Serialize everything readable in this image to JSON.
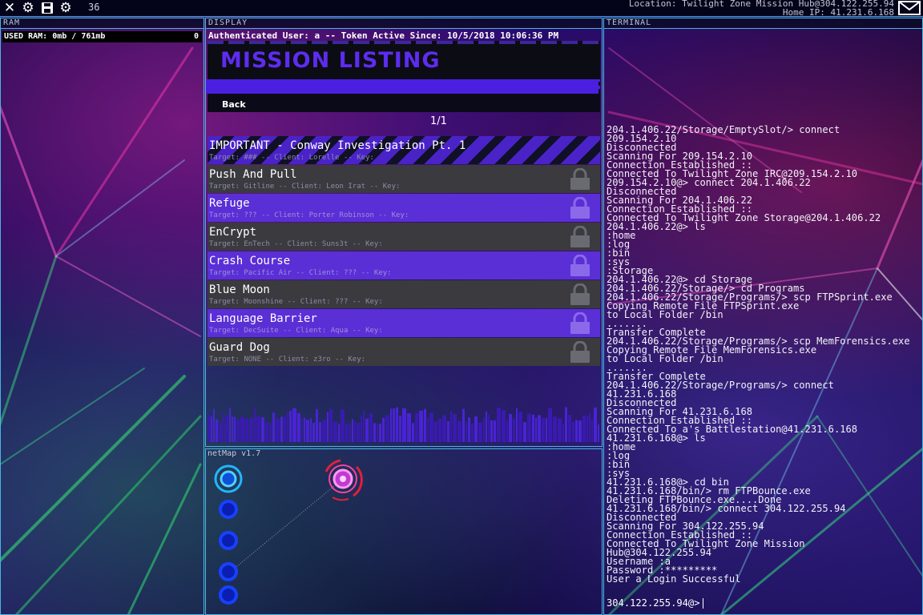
{
  "topbar": {
    "icons": [
      "close-icon",
      "gear-icon",
      "save-icon",
      "settings-icon"
    ],
    "counter": "36",
    "location": "Location: Twilight Zone Mission Hub@304.122.255.94",
    "home_ip": "Home IP: 41.231.6.168"
  },
  "ram": {
    "header": "RAM",
    "used_label": "USED RAM: 0mb / 761mb",
    "count": "0"
  },
  "display": {
    "header": "DISPLAY",
    "auth": "Authenticated User: a -- Token Active Since: 10/5/2018 10:06:36 PM",
    "title": "MISSION LISTING",
    "back_label": "Back",
    "page": "1/1",
    "missions": [
      {
        "title": "IMPORTANT - Conway Investigation Pt. 1",
        "sub": "Target: ### -- Client: Lorelle -- Key:",
        "style": "important",
        "locked": false
      },
      {
        "title": "Push And Pull",
        "sub": "Target: Gitline -- Client: Leon Irat -- Key:",
        "style": "dark",
        "locked": true
      },
      {
        "title": "Refuge",
        "sub": "Target: ??? -- Client: Porter Robinson -- Key:",
        "style": "purple",
        "locked": true
      },
      {
        "title": "EnCrypt",
        "sub": "Target: EnTech -- Client: Suns3t -- Key:",
        "style": "dark",
        "locked": true
      },
      {
        "title": "Crash Course",
        "sub": "Target: Pacific Air -- Client: ??? -- Key:",
        "style": "purple",
        "locked": true
      },
      {
        "title": "Blue Moon",
        "sub": "Target: Moonshine -- Client: ??? -- Key:",
        "style": "dark",
        "locked": true
      },
      {
        "title": "Language Barrier",
        "sub": "Target: DecSuite -- Client: Aqua -- Key:",
        "style": "purple",
        "locked": true
      },
      {
        "title": "Guard Dog",
        "sub": "Target: NONE -- Client: z3ro -- Key:",
        "style": "dark",
        "locked": true
      }
    ]
  },
  "netmap": {
    "header": "netMap v1.7"
  },
  "terminal": {
    "header": "TERMINAL",
    "lines": [
      "204.1.406.22/Storage/EmptySlot/> connect",
      "209.154.2.10",
      "Disconnected",
      "Scanning For 209.154.2.10",
      "Connection Established ::",
      "Connected To Twilight Zone IRC@209.154.2.10",
      "209.154.2.10@> connect 204.1.406.22",
      "Disconnected",
      "Scanning For 204.1.406.22",
      "Connection Established ::",
      "Connected To Twilight Zone Storage@204.1.406.22",
      "204.1.406.22@> ls",
      ":home",
      ":log",
      ":bin",
      ":sys",
      ":Storage",
      "204.1.406.22@> cd Storage",
      "204.1.406.22/Storage/> cd Programs",
      "204.1.406.22/Storage/Programs/> scp FTPSprint.exe",
      "Copying Remote File FTPSprint.exe",
      "to Local Folder /bin",
      ".......",
      "Transfer Complete",
      "204.1.406.22/Storage/Programs/> scp MemForensics.exe",
      "Copying Remote File MemForensics.exe",
      "to Local Folder /bin",
      ".......",
      "Transfer Complete",
      "204.1.406.22/Storage/Programs/> connect",
      "41.231.6.168",
      "Disconnected",
      "Scanning For 41.231.6.168",
      "Connection Established ::",
      "Connected To a's Battlestation@41.231.6.168",
      "41.231.6.168@> ls",
      ":home",
      ":log",
      ":bin",
      ":sys",
      "41.231.6.168@> cd bin",
      "41.231.6.168/bin/> rm FTPBounce.exe",
      "Deleting FTPBounce.exe....Done",
      "41.231.6.168/bin/> connect 304.122.255.94",
      "Disconnected",
      "Scanning For 304.122.255.94",
      "Connection Established ::",
      "Connected To Twilight Zone Mission",
      "Hub@304.122.255.94",
      "Username :a",
      "Password :*********",
      "User a Login Successful"
    ],
    "prompt": "304.122.255.94@>"
  }
}
